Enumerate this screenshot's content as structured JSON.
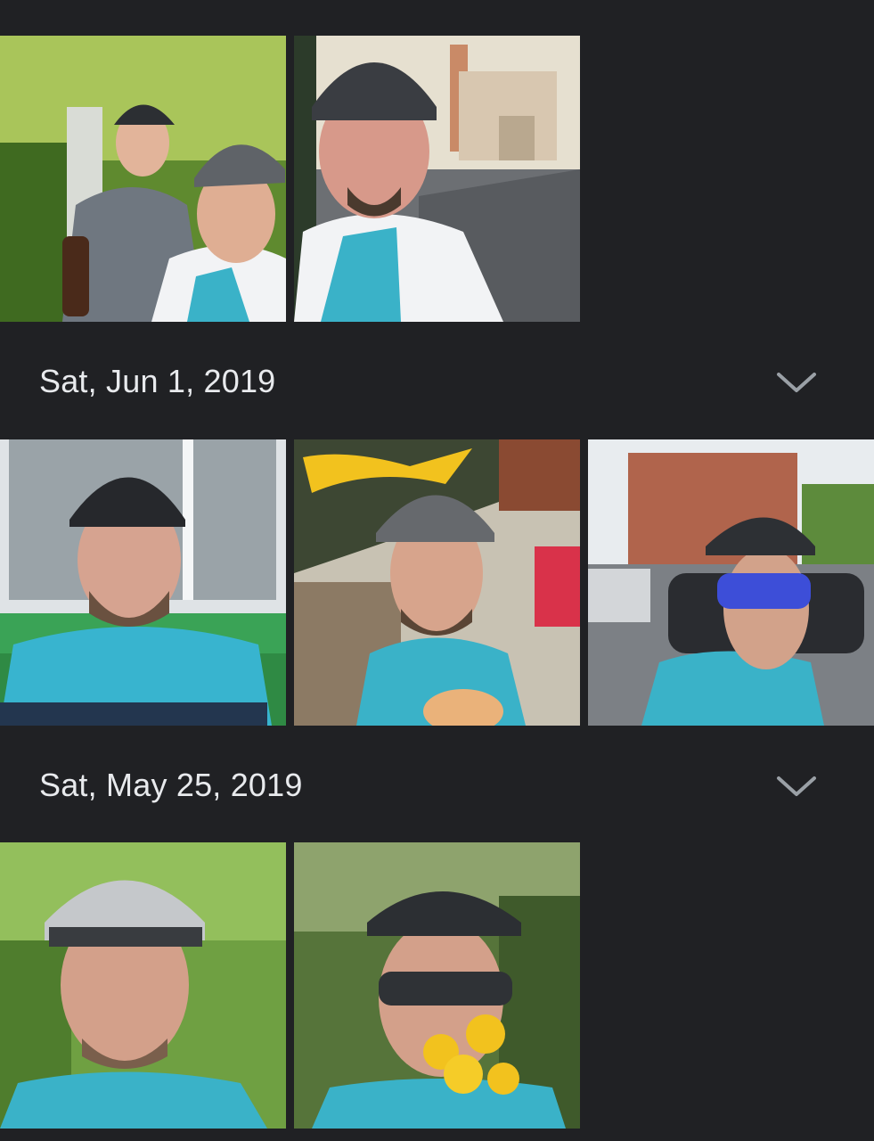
{
  "sections": [
    {
      "date": "",
      "photos": [
        {
          "icon": "photo-two-cyclists-selfie"
        },
        {
          "icon": "photo-cyclist-bell-tower"
        }
      ]
    },
    {
      "date": "Sat, Jun 1, 2019",
      "expand_icon": "chevron-down-icon",
      "photos": [
        {
          "icon": "photo-cyclist-window"
        },
        {
          "icon": "photo-cyclist-restaurant"
        },
        {
          "icon": "photo-cyclist-fortress"
        }
      ]
    },
    {
      "date": "Sat, May 25, 2019",
      "expand_icon": "chevron-down-icon",
      "photos": [
        {
          "icon": "photo-cyclist-forest"
        },
        {
          "icon": "photo-cyclist-dandelions"
        }
      ]
    }
  ],
  "colors": {
    "background": "#202124",
    "date_text": "#e8eaed",
    "chevron": "#9aa0a6"
  }
}
